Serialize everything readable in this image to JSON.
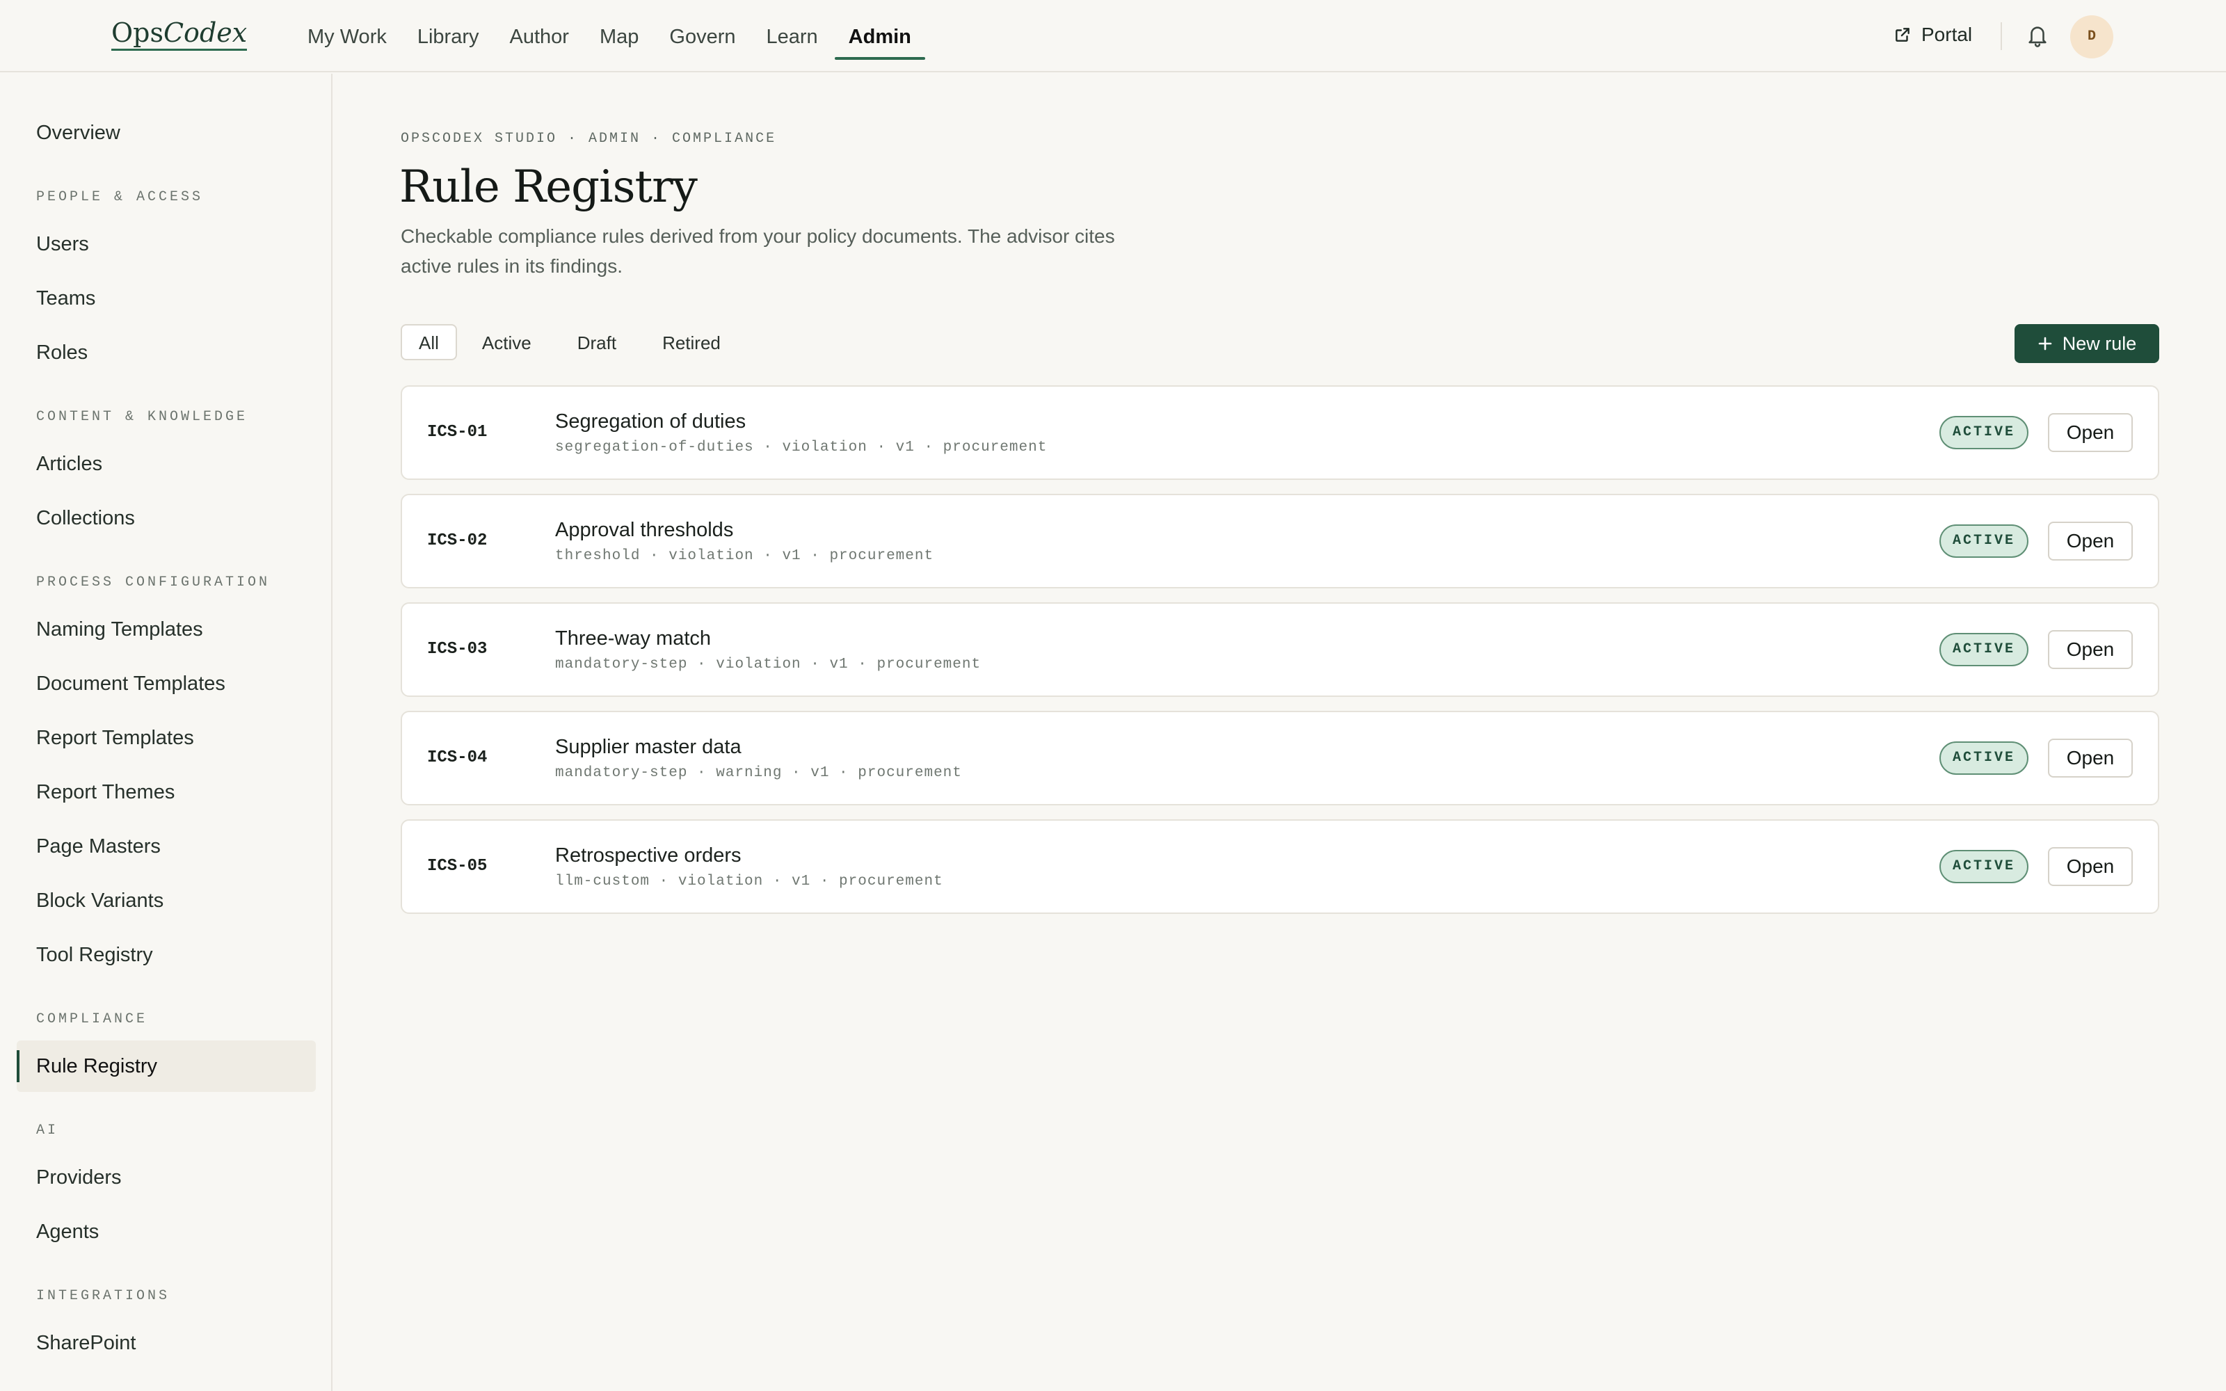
{
  "header": {
    "logo_a": "Ops",
    "logo_b": "Codex",
    "nav": [
      "My Work",
      "Library",
      "Author",
      "Map",
      "Govern",
      "Learn",
      "Admin"
    ],
    "active_nav": "Admin",
    "portal_label": "Portal",
    "avatar_initial": "D"
  },
  "sidebar": {
    "overview": "Overview",
    "sections": {
      "people": "PEOPLE & ACCESS",
      "content": "CONTENT & KNOWLEDGE",
      "process": "PROCESS CONFIGURATION",
      "compliance": "COMPLIANCE",
      "ai": "AI",
      "integrations": "INTEGRATIONS"
    },
    "items": {
      "users": "Users",
      "teams": "Teams",
      "roles": "Roles",
      "articles": "Articles",
      "collections": "Collections",
      "naming_templates": "Naming Templates",
      "document_templates": "Document Templates",
      "report_templates": "Report Templates",
      "report_themes": "Report Themes",
      "page_masters": "Page Masters",
      "block_variants": "Block Variants",
      "tool_registry": "Tool Registry",
      "rule_registry": "Rule Registry",
      "providers": "Providers",
      "agents": "Agents",
      "sharepoint": "SharePoint"
    },
    "active_item": "Rule Registry"
  },
  "main": {
    "breadcrumb": "OPSCODEX STUDIO · ADMIN · COMPLIANCE",
    "title": "Rule Registry",
    "subtitle": "Checkable compliance rules derived from your policy documents. The advisor cites active rules in its findings.",
    "filters": [
      "All",
      "Active",
      "Draft",
      "Retired"
    ],
    "active_filter": "All",
    "new_rule_label": "New rule",
    "open_label": "Open",
    "rules": [
      {
        "id": "ICS-01",
        "name": "Segregation of duties",
        "meta": "segregation-of-duties · violation · v1 · procurement",
        "status": "ACTIVE"
      },
      {
        "id": "ICS-02",
        "name": "Approval thresholds",
        "meta": "threshold · violation · v1 · procurement",
        "status": "ACTIVE"
      },
      {
        "id": "ICS-03",
        "name": "Three-way match",
        "meta": "mandatory-step · violation · v1 · procurement",
        "status": "ACTIVE"
      },
      {
        "id": "ICS-04",
        "name": "Supplier master data",
        "meta": "mandatory-step · warning · v1 · procurement",
        "status": "ACTIVE"
      },
      {
        "id": "ICS-05",
        "name": "Retrospective orders",
        "meta": "llm-custom · violation · v1 · procurement",
        "status": "ACTIVE"
      }
    ]
  },
  "colors": {
    "accent": "#1f4d3a",
    "background": "#f8f7f3",
    "status_bg": "#d8ebe0",
    "avatar_bg": "#f6e4cc"
  },
  "icons": {
    "portal": "external-link-icon",
    "bell": "bell-icon",
    "new_rule": "plus-icon"
  }
}
